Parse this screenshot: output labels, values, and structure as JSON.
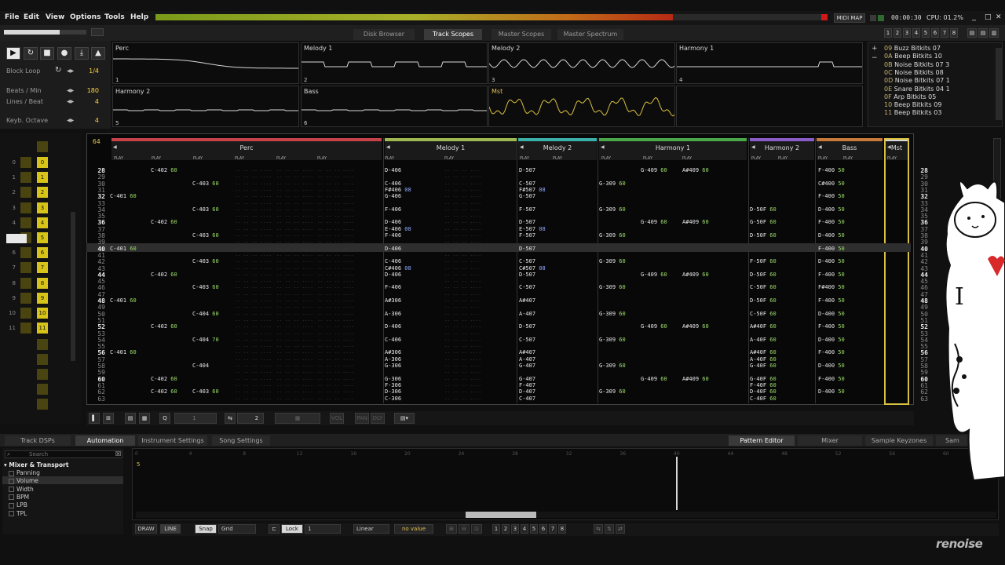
{
  "menu": [
    "File",
    "Edit",
    "View",
    "Options",
    "Tools",
    "Help"
  ],
  "status": {
    "midi_map": "MIDI MAP",
    "time": "00:00:30",
    "cpu": "CPU: 01.2%"
  },
  "window_controls": [
    "_",
    "□",
    "✕"
  ],
  "top_tabs": [
    "Disk Browser",
    "Track Scopes",
    "Master Scopes",
    "Master Spectrum"
  ],
  "top_tabs_active": "Track Scopes",
  "layout_buttons": [
    "1",
    "2",
    "3",
    "4",
    "5",
    "6",
    "7",
    "8"
  ],
  "transport": {
    "block_loop_label": "Block Loop",
    "block_loop_value": "1/4",
    "bpm_label": "Beats / Min",
    "bpm_value": "180",
    "lpb_label": "Lines / Beat",
    "lpb_value": "4",
    "octave_label": "Keyb. Octave",
    "octave_value": "4"
  },
  "scopes": [
    {
      "name": "Perc",
      "index": "1"
    },
    {
      "name": "Melody 1",
      "index": "2"
    },
    {
      "name": "Melody 2",
      "index": "3"
    },
    {
      "name": "Harmony 1",
      "index": "4"
    },
    {
      "name": "Harmony 2",
      "index": "5"
    },
    {
      "name": "Bass",
      "index": "6"
    },
    {
      "name": "Mst",
      "index": ""
    },
    {
      "name": "",
      "index": ""
    }
  ],
  "instruments": [
    {
      "id": "09",
      "name": "Buzz Bitkits 07"
    },
    {
      "id": "0A",
      "name": "Beep Bitkits 10"
    },
    {
      "id": "0B",
      "name": "Noise Bitkits 07 3"
    },
    {
      "id": "0C",
      "name": "Noise Bitkits 08"
    },
    {
      "id": "0D",
      "name": "Noise Bitkits 07 1"
    },
    {
      "id": "0E",
      "name": "Snare Bitkits 04 1"
    },
    {
      "id": "0F",
      "name": "Arp Bitkits 05"
    },
    {
      "id": "10",
      "name": "Beep Bitkits 09"
    },
    {
      "id": "11",
      "name": "Beep Bitkits 03"
    }
  ],
  "pattern": {
    "lines_count": "64",
    "current_row": "40",
    "tracks": [
      {
        "name": "Perc",
        "color": "#c8424a"
      },
      {
        "name": "Melody 1",
        "color": "#9fb850"
      },
      {
        "name": "Melody 2",
        "color": "#3ab0a8"
      },
      {
        "name": "Harmony 1",
        "color": "#4aa84a"
      },
      {
        "name": "Harmony 2",
        "color": "#8a5cc8"
      },
      {
        "name": "Bass",
        "color": "#c87a3a"
      },
      {
        "name": "Mst",
        "color": "#d8d8d8"
      }
    ],
    "play_label": "PLAY",
    "rows": [
      "28",
      "29",
      "30",
      "31",
      "32",
      "33",
      "34",
      "35",
      "36",
      "37",
      "38",
      "39",
      "40",
      "41",
      "42",
      "43",
      "44",
      "45",
      "46",
      "47",
      "48",
      "49",
      "50",
      "51",
      "52",
      "53",
      "54",
      "55",
      "56",
      "57",
      "58",
      "59",
      "60",
      "61",
      "62",
      "63"
    ],
    "perc": [
      {
        "r": "28",
        "c": "1",
        "n": "C-402",
        "v": "60"
      },
      {
        "r": "30",
        "c": "2",
        "n": "C-403",
        "v": "60"
      },
      {
        "r": "32",
        "c": "0",
        "n": "C-401",
        "v": "60"
      },
      {
        "r": "34",
        "c": "2",
        "n": "C-403",
        "v": "60"
      },
      {
        "r": "36",
        "c": "1",
        "n": "C-402",
        "v": "60"
      },
      {
        "r": "38",
        "c": "2",
        "n": "C-403",
        "v": "60"
      },
      {
        "r": "40",
        "c": "0",
        "n": "C-401",
        "v": "60"
      },
      {
        "r": "42",
        "c": "2",
        "n": "C-403",
        "v": "60"
      },
      {
        "r": "44",
        "c": "1",
        "n": "C-402",
        "v": "60"
      },
      {
        "r": "46",
        "c": "2",
        "n": "C-403",
        "v": "60"
      },
      {
        "r": "48",
        "c": "0",
        "n": "C-401",
        "v": "60"
      },
      {
        "r": "50",
        "c": "2",
        "n": "C-404",
        "v": "60"
      },
      {
        "r": "52",
        "c": "1",
        "n": "C-402",
        "v": "60"
      },
      {
        "r": "54",
        "c": "2",
        "n": "C-404",
        "v": "70"
      },
      {
        "r": "56",
        "c": "0",
        "n": "C-401",
        "v": "60"
      },
      {
        "r": "58",
        "c": "2",
        "n": "C-404",
        "v": ""
      },
      {
        "r": "60",
        "c": "1",
        "n": "C-402",
        "v": "60"
      },
      {
        "r": "62",
        "c": "1",
        "n": "C-402",
        "v": "60"
      },
      {
        "r": "62",
        "c": "2",
        "n": "C-403",
        "v": "60"
      }
    ],
    "melody1": [
      {
        "r": "28",
        "n": "D-406",
        "fx": ""
      },
      {
        "r": "30",
        "n": "C-406",
        "fx": ""
      },
      {
        "r": "31",
        "n": "F#406",
        "fx": "08"
      },
      {
        "r": "32",
        "n": "G-406",
        "fx": ""
      },
      {
        "r": "34",
        "n": "F-406",
        "fx": ""
      },
      {
        "r": "36",
        "n": "D-406",
        "fx": ""
      },
      {
        "r": "37",
        "n": "E-406",
        "fx": "08"
      },
      {
        "r": "38",
        "n": "F-406",
        "fx": ""
      },
      {
        "r": "40",
        "n": "D-406",
        "fx": ""
      },
      {
        "r": "42",
        "n": "C-406",
        "fx": ""
      },
      {
        "r": "43",
        "n": "C#406",
        "fx": "08"
      },
      {
        "r": "44",
        "n": "D-406",
        "fx": ""
      },
      {
        "r": "46",
        "n": "F-406",
        "fx": ""
      },
      {
        "r": "48",
        "n": "A#306",
        "fx": ""
      },
      {
        "r": "50",
        "n": "A-306",
        "fx": ""
      },
      {
        "r": "52",
        "n": "D-406",
        "fx": ""
      },
      {
        "r": "54",
        "n": "C-406",
        "fx": ""
      },
      {
        "r": "56",
        "n": "A#306",
        "fx": ""
      },
      {
        "r": "57",
        "n": "A-306",
        "fx": ""
      },
      {
        "r": "58",
        "n": "G-306",
        "fx": ""
      },
      {
        "r": "60",
        "n": "G-306",
        "fx": ""
      },
      {
        "r": "61",
        "n": "F-306",
        "fx": ""
      },
      {
        "r": "62",
        "n": "D-306",
        "fx": ""
      },
      {
        "r": "63",
        "n": "C-306",
        "fx": ""
      }
    ],
    "melody2": [
      {
        "r": "28",
        "n": "D-507",
        "fx": ""
      },
      {
        "r": "30",
        "n": "C-507",
        "fx": ""
      },
      {
        "r": "31",
        "n": "F#507",
        "fx": "08"
      },
      {
        "r": "32",
        "n": "G-507",
        "fx": ""
      },
      {
        "r": "34",
        "n": "F-507",
        "fx": ""
      },
      {
        "r": "36",
        "n": "D-507",
        "fx": ""
      },
      {
        "r": "37",
        "n": "E-507",
        "fx": "08"
      },
      {
        "r": "38",
        "n": "F-507",
        "fx": ""
      },
      {
        "r": "40",
        "n": "D-507",
        "fx": ""
      },
      {
        "r": "42",
        "n": "C-507",
        "fx": ""
      },
      {
        "r": "43",
        "n": "C#507",
        "fx": "08"
      },
      {
        "r": "44",
        "n": "D-507",
        "fx": ""
      },
      {
        "r": "46",
        "n": "C-507",
        "fx": ""
      },
      {
        "r": "48",
        "n": "A#407",
        "fx": ""
      },
      {
        "r": "50",
        "n": "A-407",
        "fx": ""
      },
      {
        "r": "52",
        "n": "D-507",
        "fx": ""
      },
      {
        "r": "54",
        "n": "C-507",
        "fx": ""
      },
      {
        "r": "56",
        "n": "A#407",
        "fx": ""
      },
      {
        "r": "57",
        "n": "A-407",
        "fx": ""
      },
      {
        "r": "58",
        "n": "G-407",
        "fx": ""
      },
      {
        "r": "60",
        "n": "G-407",
        "fx": ""
      },
      {
        "r": "61",
        "n": "F-407",
        "fx": ""
      },
      {
        "r": "62",
        "n": "D-407",
        "fx": ""
      },
      {
        "r": "63",
        "n": "C-407",
        "fx": ""
      }
    ],
    "harmony1": [
      {
        "r": "28",
        "c": "1",
        "n": "G-409",
        "v": "60"
      },
      {
        "r": "28",
        "c": "2",
        "n": "A#409",
        "v": "60"
      },
      {
        "r": "30",
        "c": "0",
        "n": "G-309",
        "v": "60"
      },
      {
        "r": "34",
        "c": "0",
        "n": "G-309",
        "v": "60"
      },
      {
        "r": "36",
        "c": "1",
        "n": "G-409",
        "v": "60"
      },
      {
        "r": "36",
        "c": "2",
        "n": "A#409",
        "v": "60"
      },
      {
        "r": "38",
        "c": "0",
        "n": "G-309",
        "v": "60"
      },
      {
        "r": "42",
        "c": "0",
        "n": "G-309",
        "v": "60"
      },
      {
        "r": "44",
        "c": "1",
        "n": "G-409",
        "v": "60"
      },
      {
        "r": "44",
        "c": "2",
        "n": "A#409",
        "v": "60"
      },
      {
        "r": "46",
        "c": "0",
        "n": "G-309",
        "v": "60"
      },
      {
        "r": "50",
        "c": "0",
        "n": "G-309",
        "v": "60"
      },
      {
        "r": "52",
        "c": "1",
        "n": "G-409",
        "v": "60"
      },
      {
        "r": "52",
        "c": "2",
        "n": "A#409",
        "v": "60"
      },
      {
        "r": "54",
        "c": "0",
        "n": "G-309",
        "v": "60"
      },
      {
        "r": "58",
        "c": "0",
        "n": "G-309",
        "v": "60"
      },
      {
        "r": "60",
        "c": "1",
        "n": "G-409",
        "v": "60"
      },
      {
        "r": "60",
        "c": "2",
        "n": "A#409",
        "v": "60"
      },
      {
        "r": "62",
        "c": "0",
        "n": "G-309",
        "v": "60"
      }
    ],
    "harmony2": [
      {
        "r": "34",
        "n": "D-50F",
        "v": "60"
      },
      {
        "r": "36",
        "n": "G-50F",
        "v": "60"
      },
      {
        "r": "38",
        "n": "D-50F",
        "v": "60"
      },
      {
        "r": "42",
        "n": "F-50F",
        "v": "60"
      },
      {
        "r": "44",
        "n": "D-50F",
        "v": "60"
      },
      {
        "r": "46",
        "n": "C-50F",
        "v": "60"
      },
      {
        "r": "48",
        "n": "D-50F",
        "v": "60"
      },
      {
        "r": "50",
        "n": "C-50F",
        "v": "60"
      },
      {
        "r": "52",
        "n": "A#40F",
        "v": "60"
      },
      {
        "r": "54",
        "n": "A-40F",
        "v": "60"
      },
      {
        "r": "56",
        "n": "A#40F",
        "v": "60"
      },
      {
        "r": "57",
        "n": "A-40F",
        "v": "60"
      },
      {
        "r": "58",
        "n": "G-40F",
        "v": "60"
      },
      {
        "r": "60",
        "n": "G-40F",
        "v": "60"
      },
      {
        "r": "61",
        "n": "F-40F",
        "v": "60"
      },
      {
        "r": "62",
        "n": "D-40F",
        "v": "60"
      },
      {
        "r": "63",
        "n": "C-40F",
        "v": "60"
      }
    ],
    "bass": [
      {
        "r": "28",
        "n": "F-400",
        "v": "50"
      },
      {
        "r": "30",
        "n": "C#400",
        "v": "50"
      },
      {
        "r": "32",
        "n": "F-400",
        "v": "50"
      },
      {
        "r": "34",
        "n": "D-400",
        "v": "50"
      },
      {
        "r": "36",
        "n": "F-400",
        "v": "50"
      },
      {
        "r": "38",
        "n": "D-400",
        "v": "50"
      },
      {
        "r": "40",
        "n": "F-400",
        "v": "50"
      },
      {
        "r": "42",
        "n": "D-400",
        "v": "50"
      },
      {
        "r": "44",
        "n": "F-400",
        "v": "50"
      },
      {
        "r": "46",
        "n": "F#400",
        "v": "50"
      },
      {
        "r": "48",
        "n": "F-400",
        "v": "50"
      },
      {
        "r": "50",
        "n": "D-400",
        "v": "50"
      },
      {
        "r": "52",
        "n": "F-400",
        "v": "50"
      },
      {
        "r": "54",
        "n": "D-400",
        "v": "50"
      },
      {
        "r": "56",
        "n": "F-400",
        "v": "50"
      },
      {
        "r": "58",
        "n": "D-400",
        "v": "50"
      },
      {
        "r": "60",
        "n": "F-400",
        "v": "50"
      },
      {
        "r": "62",
        "n": "D-400",
        "v": "50"
      }
    ]
  },
  "sequencer_numbers": [
    "0",
    "1",
    "2",
    "3",
    "4",
    "5",
    "6",
    "7",
    "8",
    "9",
    "10",
    "11"
  ],
  "pattern_toolbar": {
    "step": "1",
    "edit_step": "2",
    "vol": "VOL",
    "pan": "PAN",
    "dly": "DLY"
  },
  "lower_tabs_left": [
    "Track DSPs",
    "Automation",
    "Instrument Settings",
    "Song Settings"
  ],
  "lower_tabs_left_active": "Automation",
  "lower_tabs_right": [
    "Pattern Editor",
    "Mixer",
    "Sample Keyzones",
    "Sam"
  ],
  "lower_tabs_right_active": "Pattern Editor",
  "automation": {
    "search_placeholder": "Search",
    "group": "Mixer & Transport",
    "params": [
      "Panning",
      "Volume",
      "Width",
      "BPM",
      "LPB",
      "TPL"
    ],
    "ruler": [
      "0",
      "4",
      "8",
      "12",
      "16",
      "20",
      "24",
      "28",
      "32",
      "36",
      "40",
      "44",
      "48",
      "52",
      "56",
      "60"
    ],
    "draw": "DRAW",
    "line": "LINE",
    "snap": "Snap",
    "grid": "Grid",
    "lock": "Lock",
    "lock_value": "1",
    "interp": "Linear",
    "value": "no value",
    "nums": [
      "1",
      "2",
      "3",
      "4",
      "5",
      "6",
      "7",
      "8"
    ]
  },
  "logo": "renoise",
  "overlay": {
    "glyph": "I"
  }
}
